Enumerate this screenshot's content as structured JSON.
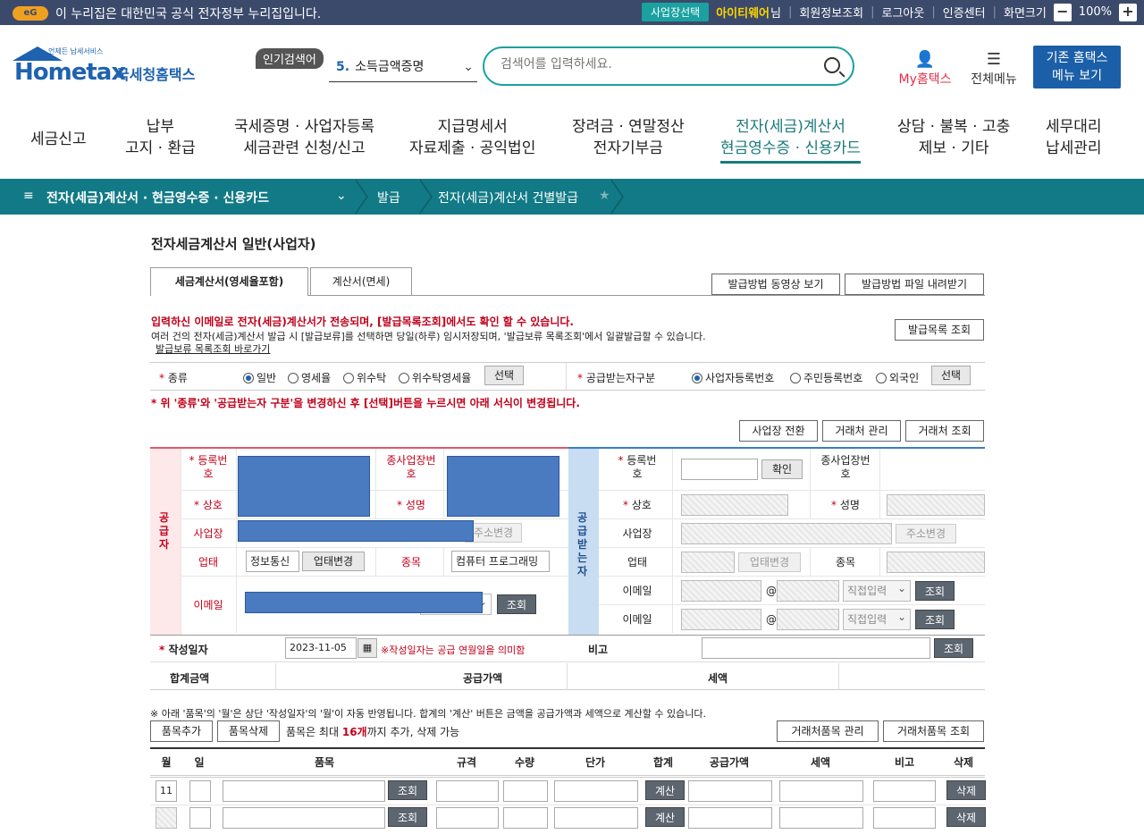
{
  "topbar": {
    "gov_notice": "이 누리집은 대한민국 공식 전자정부 누리집입니다.",
    "site_select": "사업장선택",
    "user_name": "아이티웨어",
    "user_suffix": "님",
    "member_info": "회원정보조회",
    "logout": "로그아웃",
    "cert_center": "인증센터",
    "screen_size": "화면크기",
    "zoom": "100%"
  },
  "header": {
    "logo_tag": "언제든 납세서비스",
    "logo_text": "Hometax",
    "logo_ko": "국세청홈택스",
    "popular_label": "인기검색어",
    "popular_rank": "5.",
    "popular_term": "소득금액증명",
    "search_placeholder": "검색어를 입력하세요.",
    "my_hometax": "My홈택스",
    "all_menu": "전체메뉴",
    "old_menu_line1": "기존 홈택스",
    "old_menu_line2": "메뉴 보기"
  },
  "nav": [
    {
      "line1": "세금신고",
      "line2": ""
    },
    {
      "line1": "납부",
      "line2": "고지 · 환급"
    },
    {
      "line1": "국세증명 · 사업자등록",
      "line2": "세금관련 신청/신고"
    },
    {
      "line1": "지급명세서",
      "line2": "자료제출 · 공익법인"
    },
    {
      "line1": "장려금 · 연말정산",
      "line2": "전자기부금"
    },
    {
      "line1": "전자(세금)계산서",
      "line2": "현금영수증 · 신용카드"
    },
    {
      "line1": "상담 · 불복 · 고충",
      "line2": "제보 · 기타"
    },
    {
      "line1": "세무대리",
      "line2": "납세관리"
    }
  ],
  "breadcrumb": {
    "menu": "전자(세금)계산서 · 현금영수증 · 신용카드",
    "level2": "발급",
    "level3": "전자(세금)계산서 건별발급"
  },
  "page": {
    "title": "전자세금계산서 일반(사업자)",
    "tab1": "세금계산서(영세율포함)",
    "tab2": "계산서(면세)",
    "video_btn": "발급방법 동영상 보기",
    "file_btn": "발급방법 파일 내려받기",
    "notice_red": "입력하신 이메일로 전자(세금)계산서가 전송되며, [발급목록조회]에서도 확인 할 수 있습니다.",
    "notice": "여러 건의 전자(세금)계산서 발급 시 [발급보류]를 선택하면 당일(하루) 임시저장되며, '발급보류 목록조회'에서 일괄발급할 수 있습니다.",
    "notice_link": "발급보류 목록조회 바로가기",
    "list_btn": "발급목록 조회"
  },
  "type_row": {
    "type_label": "종류",
    "types": [
      "일반",
      "영세율",
      "위수탁",
      "위수탁영세율"
    ],
    "select_btn": "선택",
    "receiver_label": "공급받는자구분",
    "receivers": [
      "사업자등록번호",
      "주민등록번호",
      "외국인"
    ],
    "select_btn2": "선택",
    "warning": "* 위 '종류'와 '공급받는자 구분'을 변경하신 후 [선택]버튼을 누르시면 아래 서식이 변경됩니다."
  },
  "actions": {
    "switch_site": "사업장 전환",
    "partner_manage": "거래처 관리",
    "partner_search": "거래처 조회"
  },
  "supplier": {
    "side_label": "공급자",
    "reg_no_label": "등록번호",
    "sub_no_label": "종사업장번호",
    "name_label": "상호",
    "rep_label": "성명",
    "address_label": "사업장",
    "address_btn": "주소변경",
    "biz_type_label": "업태",
    "biz_type_value": "정보통신",
    "biz_type_btn": "업태변경",
    "item_label": "종목",
    "item_value": "컴퓨터 프로그래밍",
    "email_label": "이메일",
    "email_btn": "조회"
  },
  "receiver": {
    "side_label": "공급받는자",
    "reg_no_label": "등록번호",
    "confirm_btn": "확인",
    "sub_no_label": "종사업장번호",
    "name_label": "상호",
    "rep_label": "성명",
    "address_label": "사업장",
    "address_btn": "주소변경",
    "biz_type_label": "업태",
    "biz_type_btn": "업태변경",
    "item_label": "종목",
    "email_label": "이메일",
    "at": "@",
    "direct_input": "직접입력",
    "email_btn": "조회"
  },
  "date_row": {
    "date_label": "작성일자",
    "date_value": "2023-11-05",
    "date_note": "※작성일자는 공급 연월일을 의미함",
    "memo_label": "비고",
    "memo_btn": "조회"
  },
  "totals": {
    "total_label": "합계금액",
    "supply_label": "공급가액",
    "tax_label": "세액"
  },
  "items": {
    "note": "※ 아래 '품목'의 '월'은 상단 '작성일자'의 '월'이 자동 반영됩니다. 합계의 '계산' 버튼은 금액을 공급가액과 세액으로 계산할 수 있습니다.",
    "add_btn": "품목추가",
    "del_btn": "품목삭제",
    "limit_pre": "품목은 최대",
    "limit_num": "16개",
    "limit_post": "까지 추가, 삭제 가능",
    "partner_items_manage": "거래처품목 관리",
    "partner_items_search": "거래처품목 조회",
    "headers": [
      "월",
      "일",
      "품목",
      "규격",
      "수량",
      "단가",
      "합계",
      "공급가액",
      "세액",
      "비고",
      "삭제"
    ],
    "row1_month": "11",
    "search_btn": "조회",
    "calc_btn": "계산",
    "delete_btn": "삭제"
  }
}
